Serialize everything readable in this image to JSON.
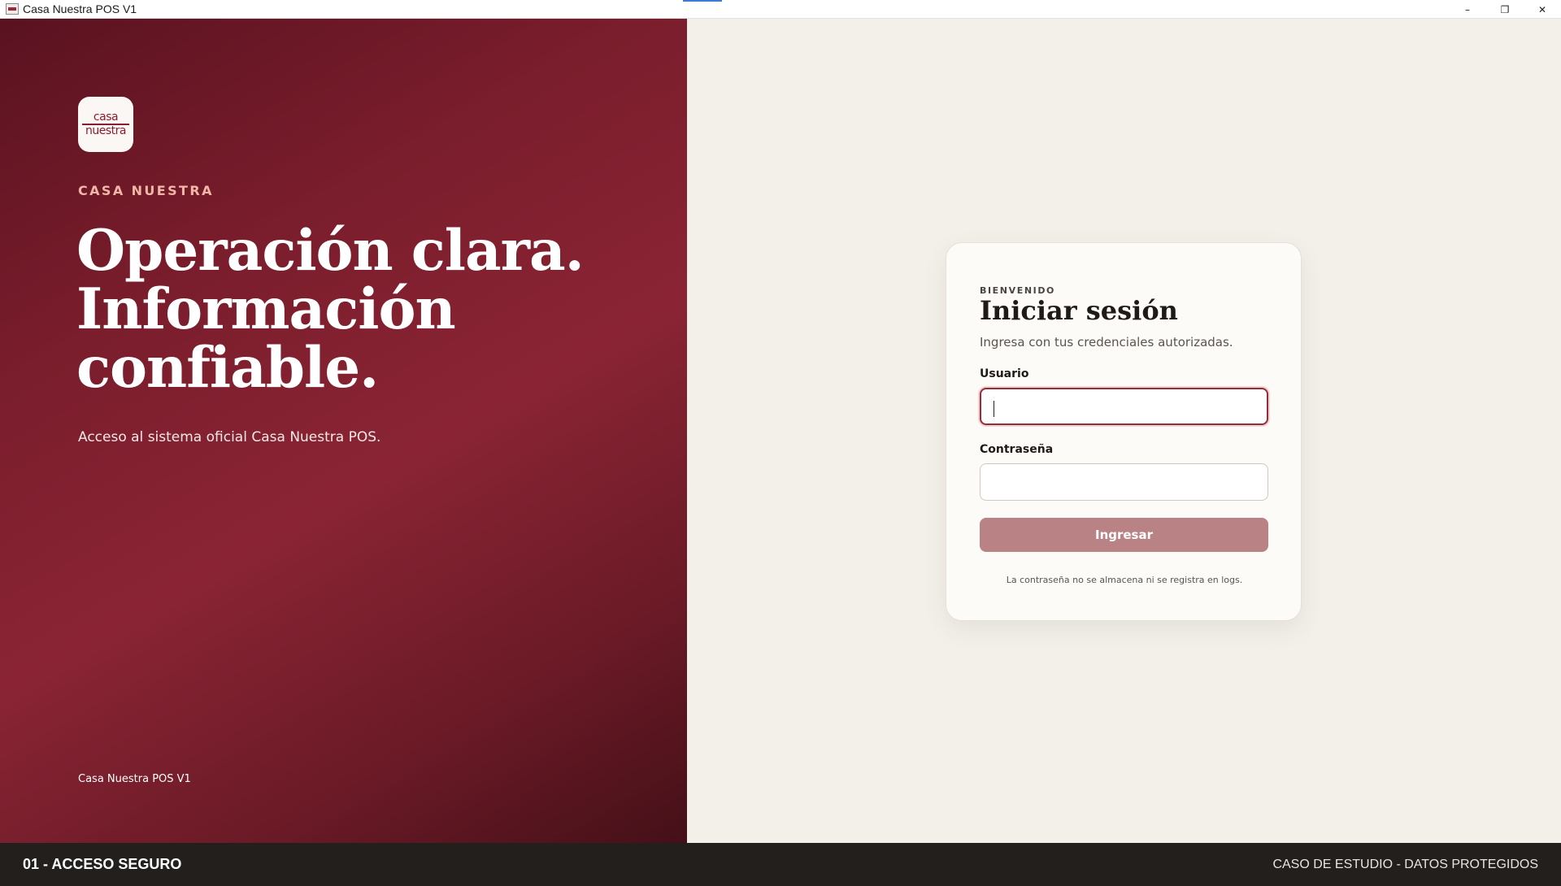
{
  "window": {
    "title": "Casa Nuestra POS V1",
    "controls": {
      "minimize": "–",
      "restore": "❐",
      "close": "✕"
    }
  },
  "hero": {
    "logo_text_top": "casa",
    "logo_text_bottom": "nuestra",
    "kicker": "CASA NUESTRA",
    "headline": [
      "Operación clara.",
      "Información",
      "confiable."
    ],
    "subtitle": "Acceso al sistema oficial Casa Nuestra POS.",
    "version": "Casa Nuestra POS V1"
  },
  "login": {
    "kicker": "BIENVENIDO",
    "title": "Iniciar sesión",
    "subtitle": "Ingresa con tus credenciales autorizadas.",
    "username_label": "Usuario",
    "username_value": "",
    "password_label": "Contraseña",
    "password_value": "",
    "submit_label": "Ingresar",
    "note": "La contraseña no se almacena ni se registra en logs."
  },
  "footer": {
    "left": "01 - ACCESO SEGURO",
    "right": "CASO DE ESTUDIO - DATOS PROTEGIDOS"
  },
  "colors": {
    "brand": "#8a2434",
    "button": "#b98285",
    "background": "#f3f0ea",
    "footer": "#221f1d"
  }
}
